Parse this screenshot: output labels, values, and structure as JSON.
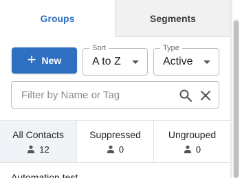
{
  "tabs": [
    {
      "label": "Groups",
      "active": true
    },
    {
      "label": "Segments",
      "active": false
    }
  ],
  "toolbar": {
    "new_label": "New",
    "sort": {
      "legend": "Sort",
      "value": "A to Z"
    },
    "type": {
      "legend": "Type",
      "value": "Active"
    }
  },
  "filter": {
    "placeholder": "Filter by Name or Tag"
  },
  "stats": [
    {
      "label": "All Contacts",
      "count": "12",
      "selected": true
    },
    {
      "label": "Suppressed",
      "count": "0",
      "selected": false
    },
    {
      "label": "Ungrouped",
      "count": "0",
      "selected": false
    }
  ],
  "list": [
    {
      "name": "Automation test"
    }
  ],
  "colors": {
    "accent": "#2f6fc1",
    "selected_bg": "#f0f3f8"
  },
  "icons": {
    "new": "plus-icon",
    "search": "search-icon",
    "clear": "close-icon",
    "count": "person-icon",
    "dropdown": "caret-down-icon"
  }
}
